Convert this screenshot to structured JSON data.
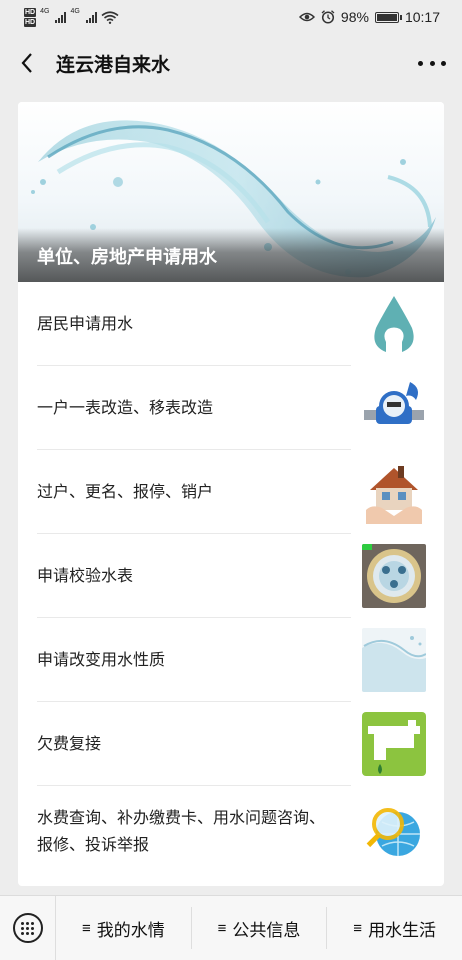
{
  "status_bar": {
    "hd1": "HD",
    "hd2": "HD",
    "net1": "4G",
    "net2": "4G",
    "battery": "98%",
    "battery_level": 0.98,
    "time": "10:17"
  },
  "nav": {
    "title": "连云港自来水"
  },
  "banner": {
    "caption": "单位、房地产申请用水"
  },
  "items": [
    {
      "label": "居民申请用水",
      "thumb": "water-drop-icon"
    },
    {
      "label": "一户一表改造、移表改造",
      "thumb": "water-meter-icon"
    },
    {
      "label": "过户、更名、报停、销户",
      "thumb": "house-icon"
    },
    {
      "label": "申请校验水表",
      "thumb": "meter-dial-icon"
    },
    {
      "label": "申请改变用水性质",
      "thumb": "water-splash-icon"
    },
    {
      "label": "欠费复接",
      "thumb": "faucet-icon"
    },
    {
      "label": "水费查询、补办缴费卡、用水问题咨询、",
      "label2": "报修、投诉举报",
      "thumb": "globe-magnifier-icon"
    }
  ],
  "bottom_menu": {
    "items": [
      {
        "icon": "≡",
        "label": "我的水情"
      },
      {
        "icon": "≡",
        "label": "公共信息"
      },
      {
        "icon": "≡",
        "label": "用水生活"
      }
    ]
  },
  "colors": {
    "background": "#ededed",
    "card": "#ffffff",
    "accent_teal": "#5fb0b3",
    "faucet_green": "#8cc43f"
  }
}
